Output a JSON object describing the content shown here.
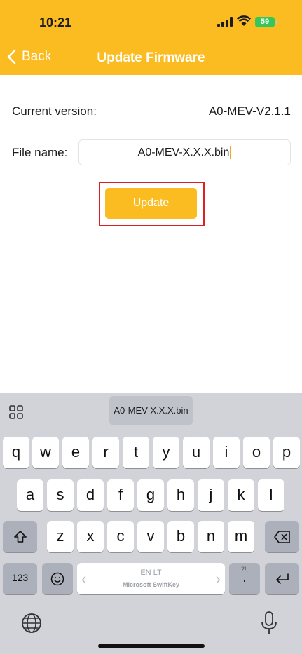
{
  "status_bar": {
    "time": "10:21",
    "battery": "59"
  },
  "nav": {
    "back_label": "Back",
    "title": "Update Firmware"
  },
  "form": {
    "current_version_label": "Current version:",
    "current_version_value": "A0-MEV-V2.1.1",
    "file_name_label": "File name:",
    "file_name_value": "A0-MEV-X.X.X.bin",
    "update_button": "Update"
  },
  "keyboard": {
    "suggestion": "A0-MEV-X.X.X.bin",
    "row1": [
      "q",
      "w",
      "e",
      "r",
      "t",
      "y",
      "u",
      "i",
      "o",
      "p"
    ],
    "row2": [
      "a",
      "s",
      "d",
      "f",
      "g",
      "h",
      "j",
      "k",
      "l"
    ],
    "row3": [
      "z",
      "x",
      "c",
      "v",
      "b",
      "n",
      "m"
    ],
    "numbers_key": "123",
    "language": "EN LT",
    "space_brand": "Microsoft SwiftKey",
    "period_key": ".",
    "punct_hint": "?!,"
  },
  "colors": {
    "accent": "#fbbc22",
    "highlight_border": "#e02020"
  }
}
